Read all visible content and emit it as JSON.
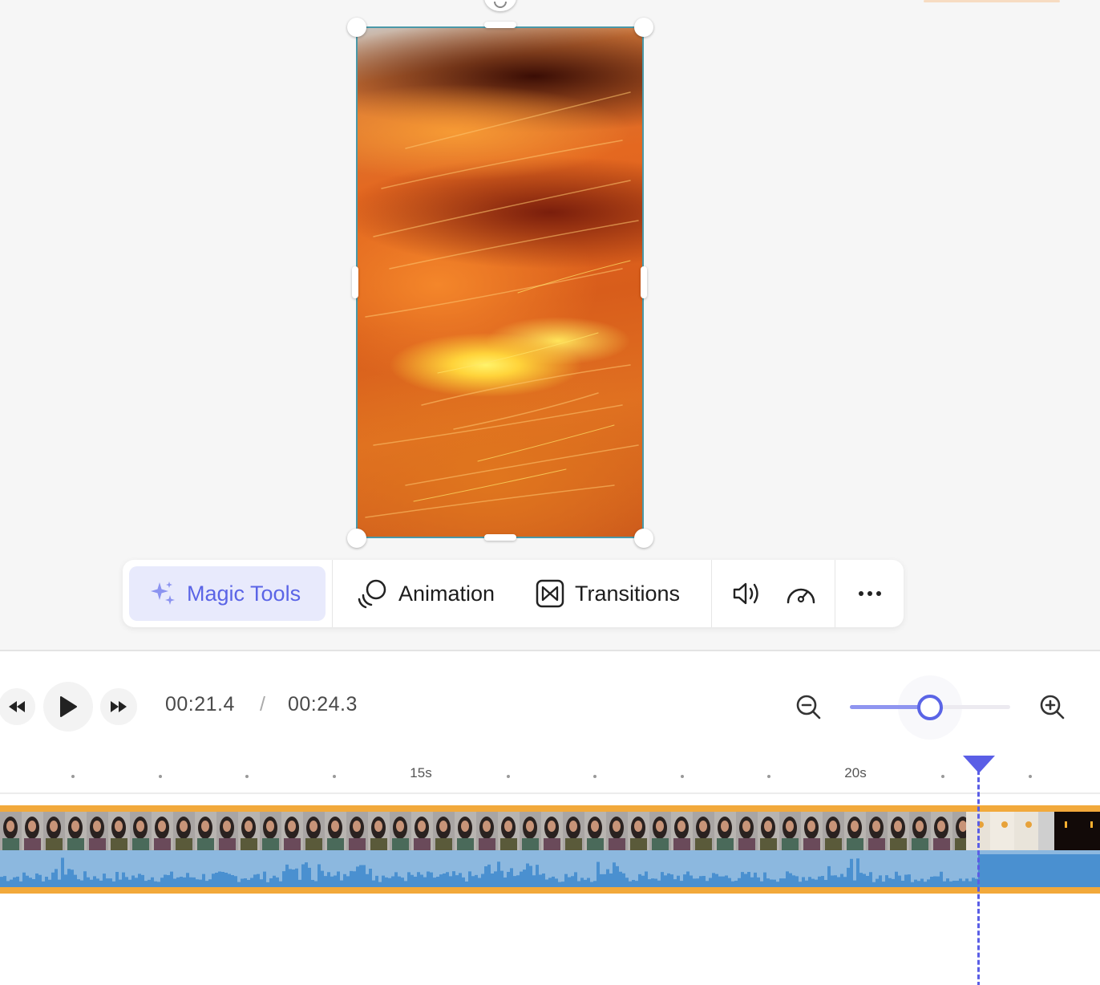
{
  "toolbar": {
    "magic_tools_label": "Magic Tools",
    "animation_label": "Animation",
    "transitions_label": "Transitions",
    "icons": [
      "sparkle-icon",
      "animation-circles-icon",
      "transitions-icon",
      "volume-icon",
      "speed-gauge-icon",
      "more-icon"
    ]
  },
  "player": {
    "current_time": "00:21.4",
    "separator": "/",
    "total_time": "00:24.3",
    "icons": [
      "rewind-icon",
      "play-icon",
      "fast-forward-icon"
    ]
  },
  "zoom": {
    "level": 0.5,
    "icons": [
      "zoom-out-icon",
      "zoom-in-icon"
    ]
  },
  "ruler": {
    "labels": [
      "15s",
      "20s"
    ]
  },
  "colors": {
    "accent": "#5a64e6",
    "accent_bg": "#e8eafc",
    "track_border": "#f2a93b",
    "audio_wave": "#4a90d0",
    "audio_bg": "#8cb8df",
    "canvas_bg": "#f6f6f6"
  }
}
